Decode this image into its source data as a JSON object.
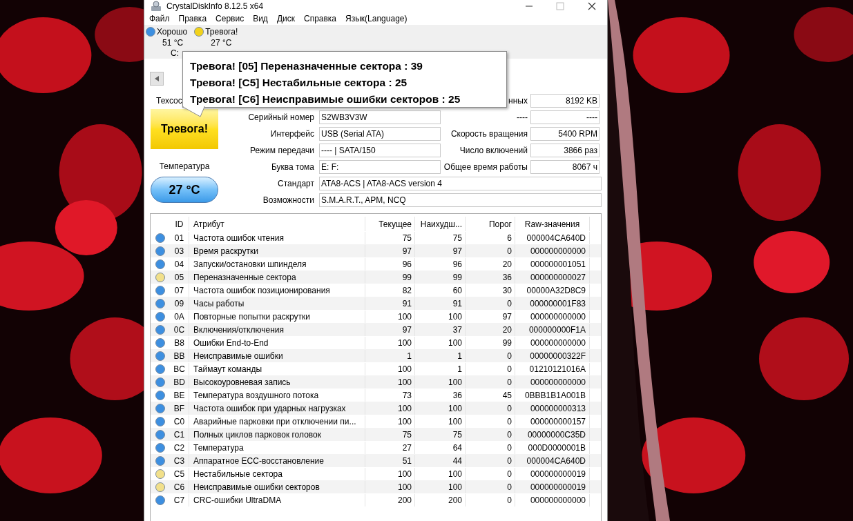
{
  "window": {
    "title": "CrystalDiskInfo 8.12.5 x64"
  },
  "menu": [
    "Файл",
    "Правка",
    "Сервис",
    "Вид",
    "Диск",
    "Справка",
    "Язык(Language)"
  ],
  "disks": [
    {
      "status": "Хорошо",
      "temperature": "51 °C",
      "drive": "C:",
      "color": "#3d8fe0"
    },
    {
      "status": "Тревога!",
      "temperature": "27 °C",
      "color": "#f2d21b"
    }
  ],
  "tooltip": {
    "lines": [
      "Тревога! [05] Переназначенные сектора : 39",
      "Тревога! [C5] Нестабильные сектора : 25",
      "Тревога! [C6] Неисправимые ошибки секторов : 25"
    ]
  },
  "health": {
    "label": "Техсос",
    "status": "Тревога!"
  },
  "temperature": {
    "label": "Температура",
    "value": "27 °C"
  },
  "info_left": [
    {
      "label": "Серийный номер",
      "value": "S2WB3V3W"
    },
    {
      "label": "Интерфейс",
      "value": "USB (Serial ATA)"
    },
    {
      "label": "Режим передачи",
      "value": "---- | SATA/150"
    },
    {
      "label": "Буква тома",
      "value": "E: F:"
    }
  ],
  "info_right": [
    {
      "label": "нных",
      "value": "8192 KB"
    },
    {
      "label": "----",
      "value": "----"
    },
    {
      "label": "Скорость вращения",
      "value": "5400 RPM"
    },
    {
      "label": "Число включений",
      "value": "3866 раз"
    },
    {
      "label": "Общее время работы",
      "value": "8067 ч"
    }
  ],
  "info_wide": [
    {
      "label": "Стандарт",
      "value": "ATA8-ACS | ATA8-ACS version 4"
    },
    {
      "label": "Возможности",
      "value": "S.M.A.R.T., APM, NCQ"
    }
  ],
  "table": {
    "columns": [
      "ID",
      "Атрибут",
      "Текущее",
      "Наихудш...",
      "Порог",
      "Raw-значения"
    ],
    "rows": [
      {
        "color": "#3d8fe0",
        "id": "01",
        "name": "Частота ошибок чтения",
        "current": "75",
        "worst": "75",
        "threshold": "6",
        "raw": "000004CA640D"
      },
      {
        "color": "#3d8fe0",
        "id": "03",
        "name": "Время раскрутки",
        "current": "97",
        "worst": "97",
        "threshold": "0",
        "raw": "000000000000"
      },
      {
        "color": "#3d8fe0",
        "id": "04",
        "name": "Запуски/остановки шпинделя",
        "current": "96",
        "worst": "96",
        "threshold": "20",
        "raw": "000000001051"
      },
      {
        "color": "#f2e08a",
        "id": "05",
        "name": "Переназначенные сектора",
        "current": "99",
        "worst": "99",
        "threshold": "36",
        "raw": "000000000027"
      },
      {
        "color": "#3d8fe0",
        "id": "07",
        "name": "Частота ошибок позиционирования",
        "current": "82",
        "worst": "60",
        "threshold": "30",
        "raw": "00000A32D8C9"
      },
      {
        "color": "#3d8fe0",
        "id": "09",
        "name": "Часы работы",
        "current": "91",
        "worst": "91",
        "threshold": "0",
        "raw": "000000001F83"
      },
      {
        "color": "#3d8fe0",
        "id": "0A",
        "name": "Повторные попытки раскрутки",
        "current": "100",
        "worst": "100",
        "threshold": "97",
        "raw": "000000000000"
      },
      {
        "color": "#3d8fe0",
        "id": "0C",
        "name": "Включения/отключения",
        "current": "97",
        "worst": "37",
        "threshold": "20",
        "raw": "000000000F1A"
      },
      {
        "color": "#3d8fe0",
        "id": "B8",
        "name": "Ошибки End-to-End",
        "current": "100",
        "worst": "100",
        "threshold": "99",
        "raw": "000000000000"
      },
      {
        "color": "#3d8fe0",
        "id": "BB",
        "name": "Неисправимые ошибки",
        "current": "1",
        "worst": "1",
        "threshold": "0",
        "raw": "00000000322F"
      },
      {
        "color": "#3d8fe0",
        "id": "BC",
        "name": "Таймаут команды",
        "current": "100",
        "worst": "1",
        "threshold": "0",
        "raw": "01210121016A"
      },
      {
        "color": "#3d8fe0",
        "id": "BD",
        "name": "Высокоуровневая запись",
        "current": "100",
        "worst": "100",
        "threshold": "0",
        "raw": "000000000000"
      },
      {
        "color": "#3d8fe0",
        "id": "BE",
        "name": "Температура воздушного потока",
        "current": "73",
        "worst": "36",
        "threshold": "45",
        "raw": "0BBB1B1A001B"
      },
      {
        "color": "#3d8fe0",
        "id": "BF",
        "name": "Частота ошибок при ударных нагрузках",
        "current": "100",
        "worst": "100",
        "threshold": "0",
        "raw": "000000000313"
      },
      {
        "color": "#3d8fe0",
        "id": "C0",
        "name": "Аварийные парковки при отключении пи...",
        "current": "100",
        "worst": "100",
        "threshold": "0",
        "raw": "000000000157"
      },
      {
        "color": "#3d8fe0",
        "id": "C1",
        "name": "Полных циклов парковок головок",
        "current": "75",
        "worst": "75",
        "threshold": "0",
        "raw": "00000000C35D"
      },
      {
        "color": "#3d8fe0",
        "id": "C2",
        "name": "Температура",
        "current": "27",
        "worst": "64",
        "threshold": "0",
        "raw": "000D0000001B"
      },
      {
        "color": "#3d8fe0",
        "id": "C3",
        "name": "Аппаратное ECC-восстановление",
        "current": "51",
        "worst": "44",
        "threshold": "0",
        "raw": "000004CA640D"
      },
      {
        "color": "#f2e08a",
        "id": "C5",
        "name": "Нестабильные сектора",
        "current": "100",
        "worst": "100",
        "threshold": "0",
        "raw": "000000000019"
      },
      {
        "color": "#f2e08a",
        "id": "C6",
        "name": "Неисправимые ошибки секторов",
        "current": "100",
        "worst": "100",
        "threshold": "0",
        "raw": "000000000019"
      },
      {
        "color": "#3d8fe0",
        "id": "C7",
        "name": "CRC-ошибки UltraDMA",
        "current": "200",
        "worst": "200",
        "threshold": "0",
        "raw": "000000000000"
      }
    ]
  }
}
